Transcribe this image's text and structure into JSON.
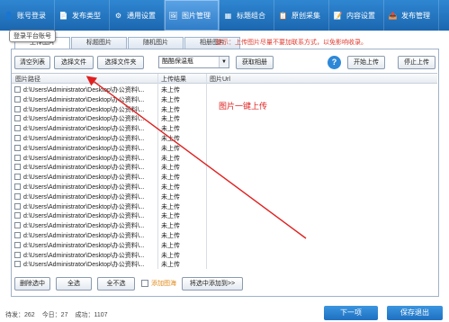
{
  "nav": [
    {
      "label": "账号登录",
      "icon": "user-icon",
      "active": false
    },
    {
      "label": "发布类型",
      "icon": "document-icon",
      "active": false
    },
    {
      "label": "通用设置",
      "icon": "gear-icon",
      "active": false
    },
    {
      "label": "图片管理",
      "icon": "image-icon",
      "active": true
    },
    {
      "label": "标题组合",
      "icon": "title-icon",
      "active": false
    },
    {
      "label": "原创采集",
      "icon": "collect-icon",
      "active": false
    },
    {
      "label": "内容设置",
      "icon": "content-icon",
      "active": false
    },
    {
      "label": "发布管理",
      "icon": "publish-icon",
      "active": false
    }
  ],
  "tooltip": "登录平台账号",
  "hint": "提示：上传图片尽量不要加联系方式，以免影响收录。",
  "tabs": [
    "上传图片",
    "标题图片",
    "随机图片",
    "相册图片"
  ],
  "toolbar": {
    "clear": "清空列表",
    "select_files": "选择文件",
    "select_folder": "选择文件夹",
    "dropdown": "酷酷保温瓶",
    "get_album": "获取相册",
    "help": "?",
    "start_upload": "开始上传",
    "stop_upload": "停止上传"
  },
  "table": {
    "headers": [
      "图片路径",
      "上传结果",
      "图片Url"
    ],
    "rows": [
      {
        "path": "d:\\Users\\Administrator\\Desktop\\办公资料\\...",
        "result": "未上传"
      },
      {
        "path": "d:\\Users\\Administrator\\Desktop\\办公资料\\...",
        "result": "未上传"
      },
      {
        "path": "d:\\Users\\Administrator\\Desktop\\办公资料\\...",
        "result": "未上传"
      },
      {
        "path": "d:\\Users\\Administrator\\Desktop\\办公资料\\...",
        "result": "未上传"
      },
      {
        "path": "d:\\Users\\Administrator\\Desktop\\办公资料\\...",
        "result": "未上传"
      },
      {
        "path": "d:\\Users\\Administrator\\Desktop\\办公资料\\...",
        "result": "未上传"
      },
      {
        "path": "d:\\Users\\Administrator\\Desktop\\办公资料\\...",
        "result": "未上传"
      },
      {
        "path": "d:\\Users\\Administrator\\Desktop\\办公资料\\...",
        "result": "未上传"
      },
      {
        "path": "d:\\Users\\Administrator\\Desktop\\办公资料\\...",
        "result": "未上传"
      },
      {
        "path": "d:\\Users\\Administrator\\Desktop\\办公资料\\...",
        "result": "未上传"
      },
      {
        "path": "d:\\Users\\Administrator\\Desktop\\办公资料\\...",
        "result": "未上传"
      },
      {
        "path": "d:\\Users\\Administrator\\Desktop\\办公资料\\...",
        "result": "未上传"
      },
      {
        "path": "d:\\Users\\Administrator\\Desktop\\办公资料\\...",
        "result": "未上传"
      },
      {
        "path": "d:\\Users\\Administrator\\Desktop\\办公资料\\...",
        "result": "未上传"
      },
      {
        "path": "d:\\Users\\Administrator\\Desktop\\办公资料\\...",
        "result": "未上传"
      },
      {
        "path": "d:\\Users\\Administrator\\Desktop\\办公资料\\...",
        "result": "未上传"
      },
      {
        "path": "d:\\Users\\Administrator\\Desktop\\办公资料\\...",
        "result": "未上传"
      },
      {
        "path": "d:\\Users\\Administrator\\Desktop\\办公资料\\...",
        "result": "未上传"
      },
      {
        "path": "d:\\Users\\Administrator\\Desktop\\办公资料\\...",
        "result": "未上传"
      }
    ]
  },
  "annotation": "图片一键上传",
  "bottom": {
    "delete_selected": "删除选中",
    "select_all": "全选",
    "select_none": "全不选",
    "add_watermark": "添加图海",
    "add_selected": "将选中添加到>>"
  },
  "stats": {
    "pending": "待发：262",
    "today": "今日：27",
    "success": "成功：1107"
  },
  "footer": {
    "next": "下一项",
    "save_exit": "保存退出"
  },
  "colors": {
    "accent": "#1f70c0",
    "hint": "#e03a2e",
    "annotation": "#e02020"
  }
}
